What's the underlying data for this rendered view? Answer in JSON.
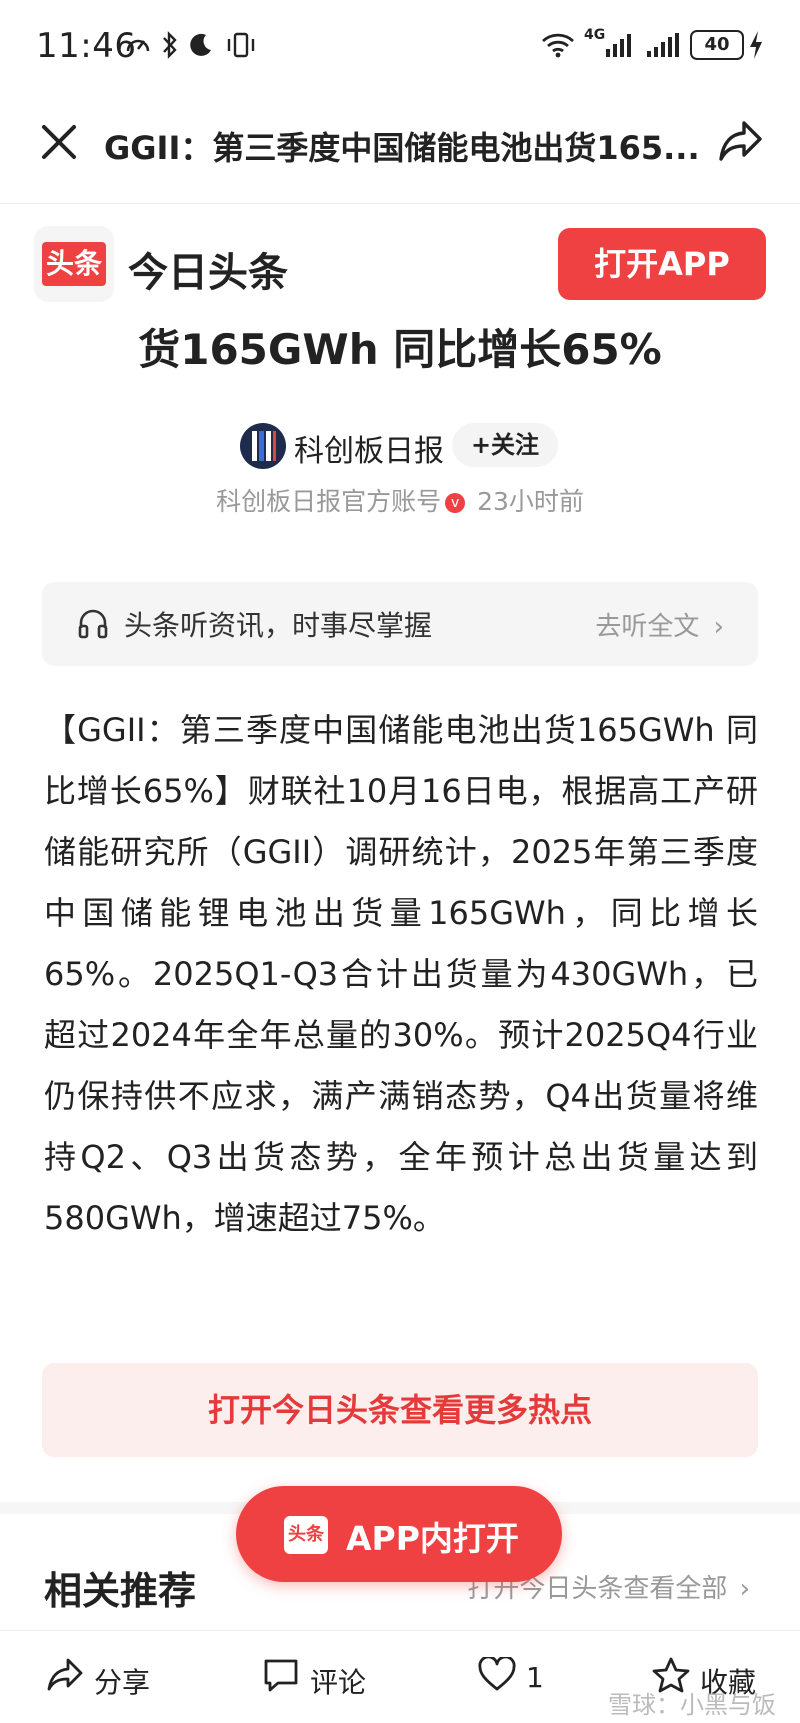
{
  "status_bar": {
    "time": "11:46",
    "network": "4G",
    "battery": "40"
  },
  "nav": {
    "title": "GGII：第三季度中国储能电池出货165..."
  },
  "header": {
    "logo_text": "头条",
    "brand_name": "今日头条",
    "open_app_label": "打开APP"
  },
  "article": {
    "title_tail": "货165GWh 同比增长65%",
    "author": "科创板日报",
    "follow_label": "+关注",
    "account_type": "科创板日报官方账号",
    "verified_badge": "v",
    "time_ago": "23小时前",
    "body": "【GGII：第三季度中国储能电池出货165GWh 同比增长65%】财联社10月16日电，根据高工产研储能研究所（GGII）调研统计，2025年第三季度中国储能锂电池出货量165GWh，同比增长65%。2025Q1-Q3合计出货量为430GWh，已超过2024年全年总量的30%。预计2025Q4行业仍保持供不应求，满产满销态势，Q4出货量将维持Q2、Q3出货态势，全年预计总出货量达到580GWh，增速超过75%。"
  },
  "listen": {
    "text": "头条听资讯，时事尽掌握",
    "link": "去听全文"
  },
  "more_hot": {
    "label": "打开今日头条查看更多热点"
  },
  "related": {
    "title": "相关推荐",
    "link": "打开今日头条查看全部"
  },
  "float_button": {
    "logo_text": "头条",
    "label": "APP内打开"
  },
  "bottom_bar": {
    "share": "分享",
    "comment": "评论",
    "like_count": "1",
    "collect": "收藏",
    "watermark": "雪球：小黑与饭"
  }
}
